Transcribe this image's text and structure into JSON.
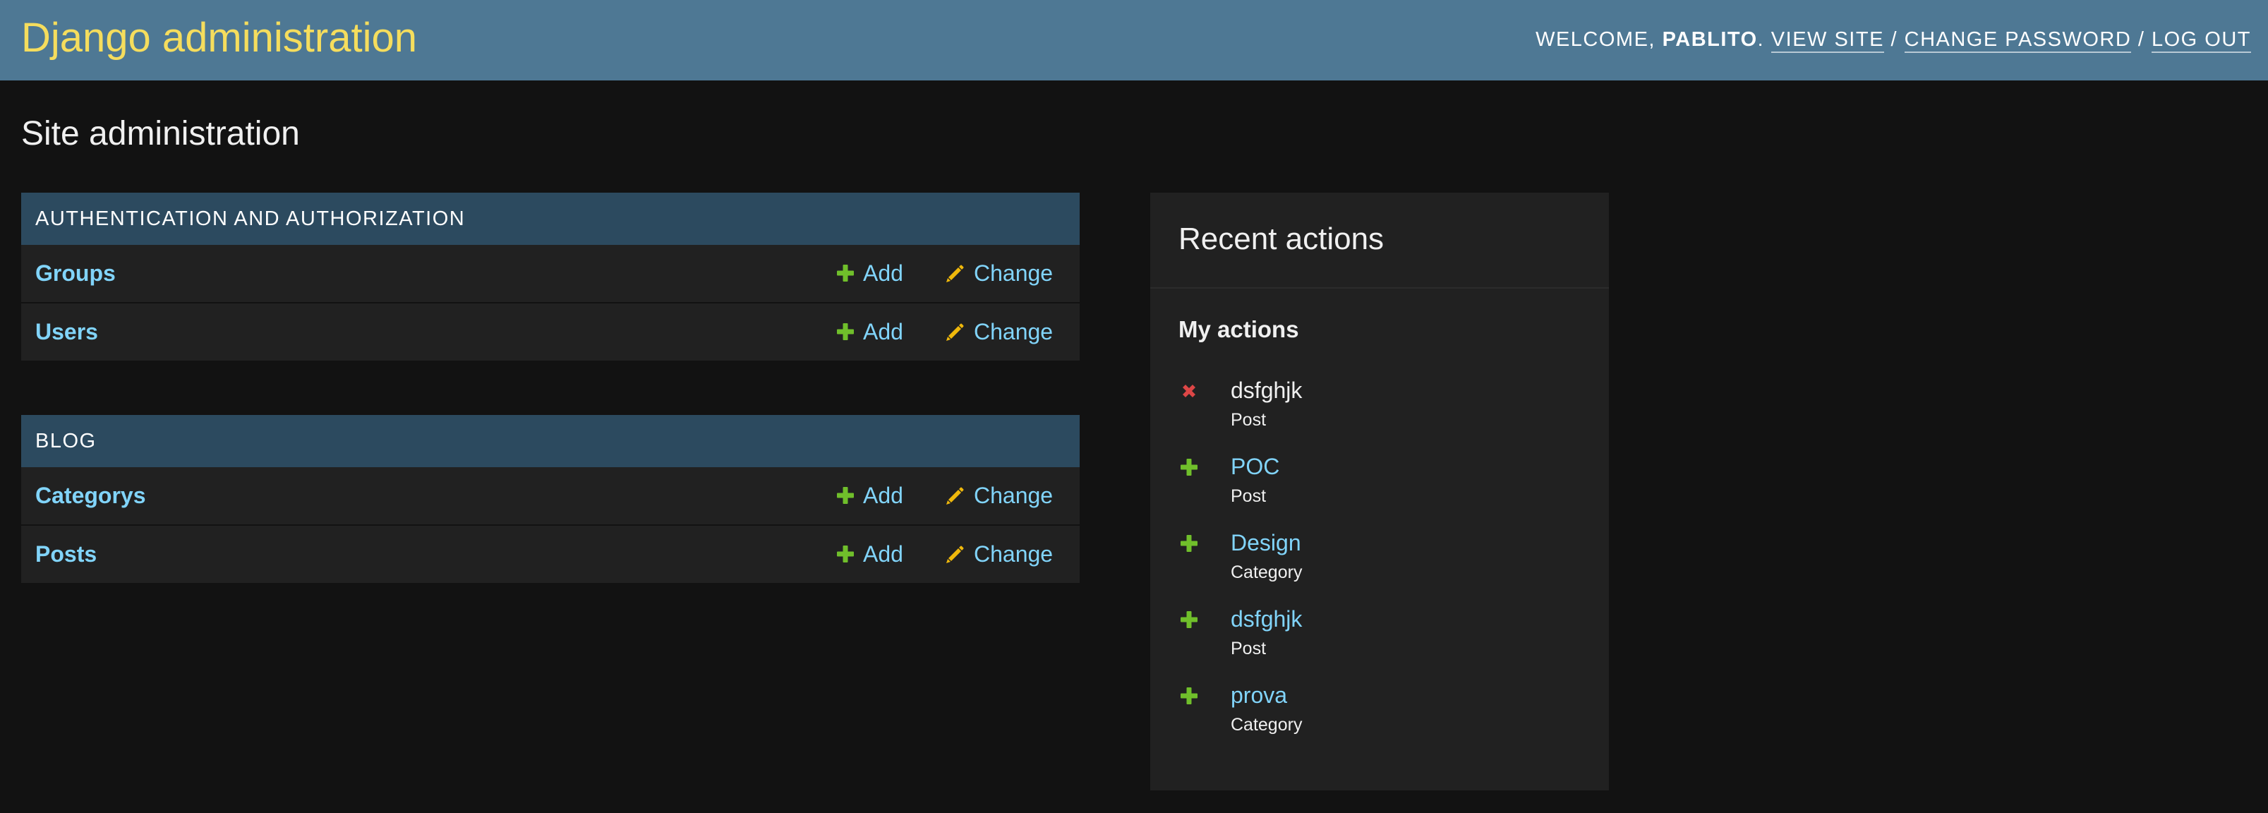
{
  "header": {
    "site_title": "Django administration",
    "user_tools": {
      "welcome": "Welcome,",
      "username": "pablito",
      "period": ".",
      "view_site": "View site",
      "change_password": "Change password",
      "log_out": "Log out",
      "separator": "/"
    }
  },
  "page_title": "Site administration",
  "modules": [
    {
      "caption": "Authentication and Authorization",
      "models": [
        {
          "name": "Groups",
          "add_label": "Add",
          "change_label": "Change"
        },
        {
          "name": "Users",
          "add_label": "Add",
          "change_label": "Change"
        }
      ]
    },
    {
      "caption": "Blog",
      "models": [
        {
          "name": "Categorys",
          "add_label": "Add",
          "change_label": "Change"
        },
        {
          "name": "Posts",
          "add_label": "Add",
          "change_label": "Change"
        }
      ]
    }
  ],
  "recent_actions": {
    "title": "Recent actions",
    "subtitle": "My actions",
    "items": [
      {
        "name": "dsfghjk",
        "type": "Post",
        "action": "deleted",
        "icon": "delete-icon"
      },
      {
        "name": "POC",
        "type": "Post",
        "action": "added",
        "icon": "add-icon"
      },
      {
        "name": "Design",
        "type": "Category",
        "action": "added",
        "icon": "add-icon"
      },
      {
        "name": "dsfghjk",
        "type": "Post",
        "action": "added",
        "icon": "add-icon"
      },
      {
        "name": "prova",
        "type": "Category",
        "action": "added",
        "icon": "add-icon"
      }
    ]
  },
  "colors": {
    "header_bg": "#4e7894",
    "title_yellow": "#f5dd5d",
    "link_blue": "#81d4fa",
    "module_caption_bg": "#2c4a5f",
    "add_green": "#70bf2b",
    "change_yellow": "#efb80b",
    "delete_red": "#dd4646",
    "body_bg": "#121212",
    "panel_bg": "#212121"
  }
}
